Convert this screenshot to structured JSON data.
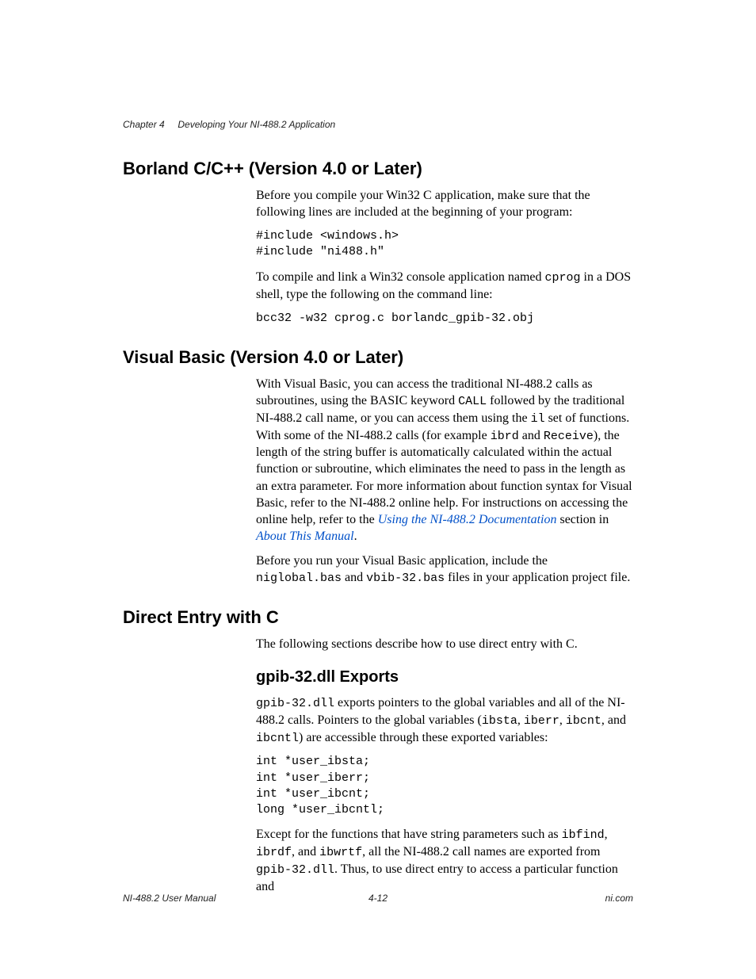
{
  "header": {
    "chapter": "Chapter 4",
    "title": "Developing Your NI-488.2 Application"
  },
  "sections": {
    "borland": {
      "heading": "Borland C/C++ (Version 4.0 or Later)",
      "p1": "Before you compile your Win32 C application, make sure that the following lines are included at the beginning of your program:",
      "code1": "#include <windows.h>\n#include \"ni488.h\"",
      "p2_a": "To compile and link a Win32 console application named ",
      "p2_mono": "cprog",
      "p2_b": " in a DOS shell, type the following on the command line:",
      "code2": "bcc32 -w32 cprog.c borlandc_gpib-32.obj"
    },
    "vb": {
      "heading": "Visual Basic (Version 4.0 or Later)",
      "p1_a": "With Visual Basic, you can access the traditional NI-488.2 calls as subroutines, using the BASIC keyword ",
      "p1_m1": "CALL",
      "p1_b": " followed by the traditional NI-488.2 call name, or you can access them using the ",
      "p1_m2": "il",
      "p1_c": " set of functions. With some of the NI-488.2 calls (for example ",
      "p1_m3": "ibrd",
      "p1_d": " and ",
      "p1_m4": "Receive",
      "p1_e": "), the length of the string buffer is automatically calculated within the actual function or subroutine, which eliminates the need to pass in the length as an extra parameter. For more information about function syntax for Visual Basic, refer to the NI-488.2 online help. For instructions on accessing the online help, refer to the ",
      "p1_link1": "Using the NI-488.2 Documentation",
      "p1_f": " section in ",
      "p1_link2": "About This Manual",
      "p1_g": ".",
      "p2_a": "Before you run your Visual Basic application, include the ",
      "p2_m1": "niglobal.bas",
      "p2_b": " and ",
      "p2_m2": "vbib-32.bas",
      "p2_c": " files in your application project file."
    },
    "direct": {
      "heading": "Direct Entry with C",
      "p1": "The following sections describe how to use direct entry with C.",
      "sub": {
        "heading": "gpib-32.dll Exports",
        "p1_m1": "gpib-32.dll",
        "p1_a": " exports pointers to the global variables and all of the NI-488.2 calls. Pointers to the global variables (",
        "p1_m2": "ibsta",
        "p1_b": ", ",
        "p1_m3": "iberr",
        "p1_c": ", ",
        "p1_m4": "ibcnt",
        "p1_d": ", and ",
        "p1_m5": "ibcntl",
        "p1_e": ") are accessible through these exported variables:",
        "code1": "int *user_ibsta;\nint *user_iberr;\nint *user_ibcnt;\nlong *user_ibcntl;",
        "p2_a": "Except for the functions that have string parameters such as ",
        "p2_m1": "ibfind",
        "p2_b": ", ",
        "p2_m2": "ibrdf",
        "p2_c": ", and ",
        "p2_m3": "ibwrtf",
        "p2_d": ", all the NI-488.2 call names are exported from ",
        "p2_m4": "gpib-32.dll",
        "p2_e": ". Thus, to use direct entry to access a particular function and"
      }
    }
  },
  "footer": {
    "left": "NI-488.2 User Manual",
    "center": "4-12",
    "right": "ni.com"
  }
}
